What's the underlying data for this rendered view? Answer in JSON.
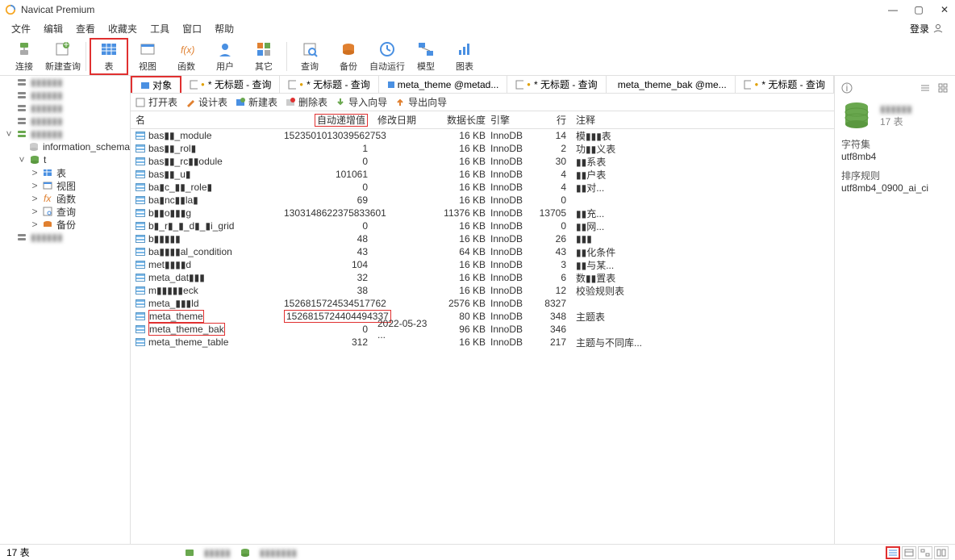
{
  "title": "Navicat Premium",
  "menu": [
    "文件",
    "编辑",
    "查看",
    "收藏夹",
    "工具",
    "窗口",
    "帮助"
  ],
  "login": "登录",
  "toolbar": [
    {
      "label": "连接",
      "id": "connect"
    },
    {
      "label": "新建查询",
      "id": "new-query"
    },
    {
      "label": "表",
      "id": "table",
      "highlighted": true
    },
    {
      "label": "视图",
      "id": "view"
    },
    {
      "label": "函数",
      "id": "function"
    },
    {
      "label": "用户",
      "id": "user"
    },
    {
      "label": "其它",
      "id": "other"
    },
    {
      "label": "查询",
      "id": "query"
    },
    {
      "label": "备份",
      "id": "backup"
    },
    {
      "label": "自动运行",
      "id": "autorun"
    },
    {
      "label": "模型",
      "id": "model"
    },
    {
      "label": "图表",
      "id": "chart"
    }
  ],
  "tree": [
    {
      "label": "",
      "icon": "server",
      "expand": ""
    },
    {
      "label": "",
      "icon": "server",
      "expand": ""
    },
    {
      "label": "",
      "icon": "server",
      "expand": ""
    },
    {
      "label": "",
      "icon": "server",
      "expand": ""
    },
    {
      "label": "",
      "icon": "server-on",
      "expand": "˅"
    },
    {
      "label": "information_schema",
      "icon": "db",
      "expand": "",
      "indent": 1
    },
    {
      "label": "t",
      "icon": "db-on",
      "expand": "˅",
      "indent": 1
    },
    {
      "label": "表",
      "icon": "table",
      "expand": ">",
      "indent": 2
    },
    {
      "label": "视图",
      "icon": "view",
      "expand": ">",
      "indent": 2
    },
    {
      "label": "函数",
      "icon": "fx",
      "expand": ">",
      "indent": 2
    },
    {
      "label": "查询",
      "icon": "query",
      "expand": ">",
      "indent": 2
    },
    {
      "label": "备份",
      "icon": "backup",
      "expand": ">",
      "indent": 2
    },
    {
      "label": "",
      "icon": "server",
      "expand": ""
    }
  ],
  "tabs": [
    {
      "label": "对象",
      "active": true
    },
    {
      "label": "* 无标题 - 查询",
      "star": true
    },
    {
      "label": "* 无标题 - 查询",
      "star": true
    },
    {
      "label": "meta_theme @metad...",
      "star": false
    },
    {
      "label": "* 无标题 - 查询",
      "star": true
    },
    {
      "label": "meta_theme_bak @me...",
      "star": false
    },
    {
      "label": "* 无标题 - 查询",
      "star": true
    }
  ],
  "innerToolbar": {
    "open": "打开表",
    "design": "设计表",
    "new": "新建表",
    "delete": "删除表",
    "import": "导入向导",
    "export": "导出向导"
  },
  "columns": {
    "name": "名",
    "autoinc": "自动递增值",
    "date": "修改日期",
    "len": "数据长度",
    "engine": "引擎",
    "rows": "行",
    "comment": "注释"
  },
  "rows": [
    {
      "name": "bas▮▮_module",
      "autoinc": "1523501013039562753",
      "len": "16 KB",
      "engine": "InnoDB",
      "rows": "14",
      "comment": "模▮▮▮表"
    },
    {
      "name": "bas▮▮_rol▮",
      "autoinc": "1",
      "len": "16 KB",
      "engine": "InnoDB",
      "rows": "2",
      "comment": "功▮▮义表"
    },
    {
      "name": "bas▮▮_rc▮▮odule",
      "autoinc": "0",
      "len": "16 KB",
      "engine": "InnoDB",
      "rows": "30",
      "comment": "▮▮系表"
    },
    {
      "name": "bas▮▮_u▮",
      "autoinc": "101061",
      "len": "16 KB",
      "engine": "InnoDB",
      "rows": "4",
      "comment": "▮▮户表"
    },
    {
      "name": "ba▮c_▮▮_role▮",
      "autoinc": "0",
      "len": "16 KB",
      "engine": "InnoDB",
      "rows": "4",
      "comment": "▮▮对..."
    },
    {
      "name": "ba▮nc▮▮la▮",
      "autoinc": "69",
      "len": "16 KB",
      "engine": "InnoDB",
      "rows": "0",
      "comment": ""
    },
    {
      "name": "b▮▮o▮▮▮g",
      "autoinc": "1303148622375833601",
      "len": "11376 KB",
      "engine": "InnoDB",
      "rows": "13705",
      "comment": "▮▮充..."
    },
    {
      "name": "b▮_r▮_▮_d▮_▮i_grid",
      "autoinc": "0",
      "len": "16 KB",
      "engine": "InnoDB",
      "rows": "0",
      "comment": "▮▮网..."
    },
    {
      "name": "b▮▮▮▮▮",
      "autoinc": "48",
      "len": "16 KB",
      "engine": "InnoDB",
      "rows": "26",
      "comment": "▮▮▮"
    },
    {
      "name": "ba▮▮▮▮al_condition",
      "autoinc": "43",
      "len": "64 KB",
      "engine": "InnoDB",
      "rows": "43",
      "comment": "▮▮化条件"
    },
    {
      "name": "met▮▮▮▮d",
      "autoinc": "104",
      "len": "16 KB",
      "engine": "InnoDB",
      "rows": "3",
      "comment": "▮▮与某..."
    },
    {
      "name": "meta_dat▮▮▮",
      "autoinc": "32",
      "len": "16 KB",
      "engine": "InnoDB",
      "rows": "6",
      "comment": "数▮▮置表"
    },
    {
      "name": "m▮▮▮▮▮eck",
      "autoinc": "38",
      "len": "16 KB",
      "engine": "InnoDB",
      "rows": "12",
      "comment": "校验规则表"
    },
    {
      "name": "meta_▮▮▮ld",
      "autoinc": "1526815724534517762",
      "len": "2576 KB",
      "engine": "InnoDB",
      "rows": "8327",
      "comment": ""
    },
    {
      "name": "meta_theme",
      "autoinc": "1526815724404494337",
      "len": "80 KB",
      "engine": "InnoDB",
      "rows": "348",
      "comment": "主题表",
      "hl_name": true,
      "hl_autoinc": true
    },
    {
      "name": "meta_theme_bak",
      "autoinc": "0",
      "date": "2022-05-23 ...",
      "len": "96 KB",
      "engine": "InnoDB",
      "rows": "346",
      "comment": "",
      "hl_name": true
    },
    {
      "name": "meta_theme_table",
      "autoinc": "312",
      "len": "16 KB",
      "engine": "InnoDB",
      "rows": "217",
      "comment": "主题与不同库..."
    }
  ],
  "rightPanel": {
    "count": "17 表",
    "charsetLabel": "字符集",
    "charset": "utf8mb4",
    "collationLabel": "排序规则",
    "collation": "utf8mb4_0900_ai_ci"
  },
  "statusbar": {
    "count": "17 表"
  }
}
